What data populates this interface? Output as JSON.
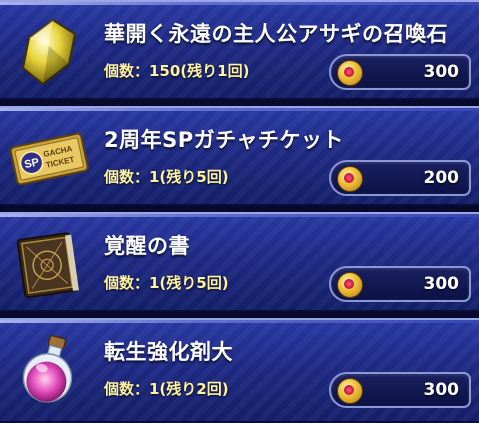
{
  "items": [
    {
      "name": "華開く永遠の主人公アサギの召喚石",
      "count": "個数：150(残り1回)",
      "price": "300",
      "icon": "yellow-gem-icon"
    },
    {
      "name": "2周年SPガチャチケット",
      "count": "個数：1(残り5回)",
      "price": "200",
      "icon": "gacha-ticket-icon"
    },
    {
      "name": "覚醒の書",
      "count": "個数：1(残り5回)",
      "price": "300",
      "icon": "awakening-book-icon"
    },
    {
      "name": "転生強化剤大",
      "count": "個数：1(残り2回)",
      "price": "300",
      "icon": "potion-bottle-icon"
    }
  ],
  "ticket_text": {
    "sp": "SP",
    "line1": "GACHA",
    "line2": "TICKET"
  },
  "colors": {
    "panel": "#1f2b86",
    "count_text": "#fff3a0",
    "coin": "#f0c33a"
  }
}
